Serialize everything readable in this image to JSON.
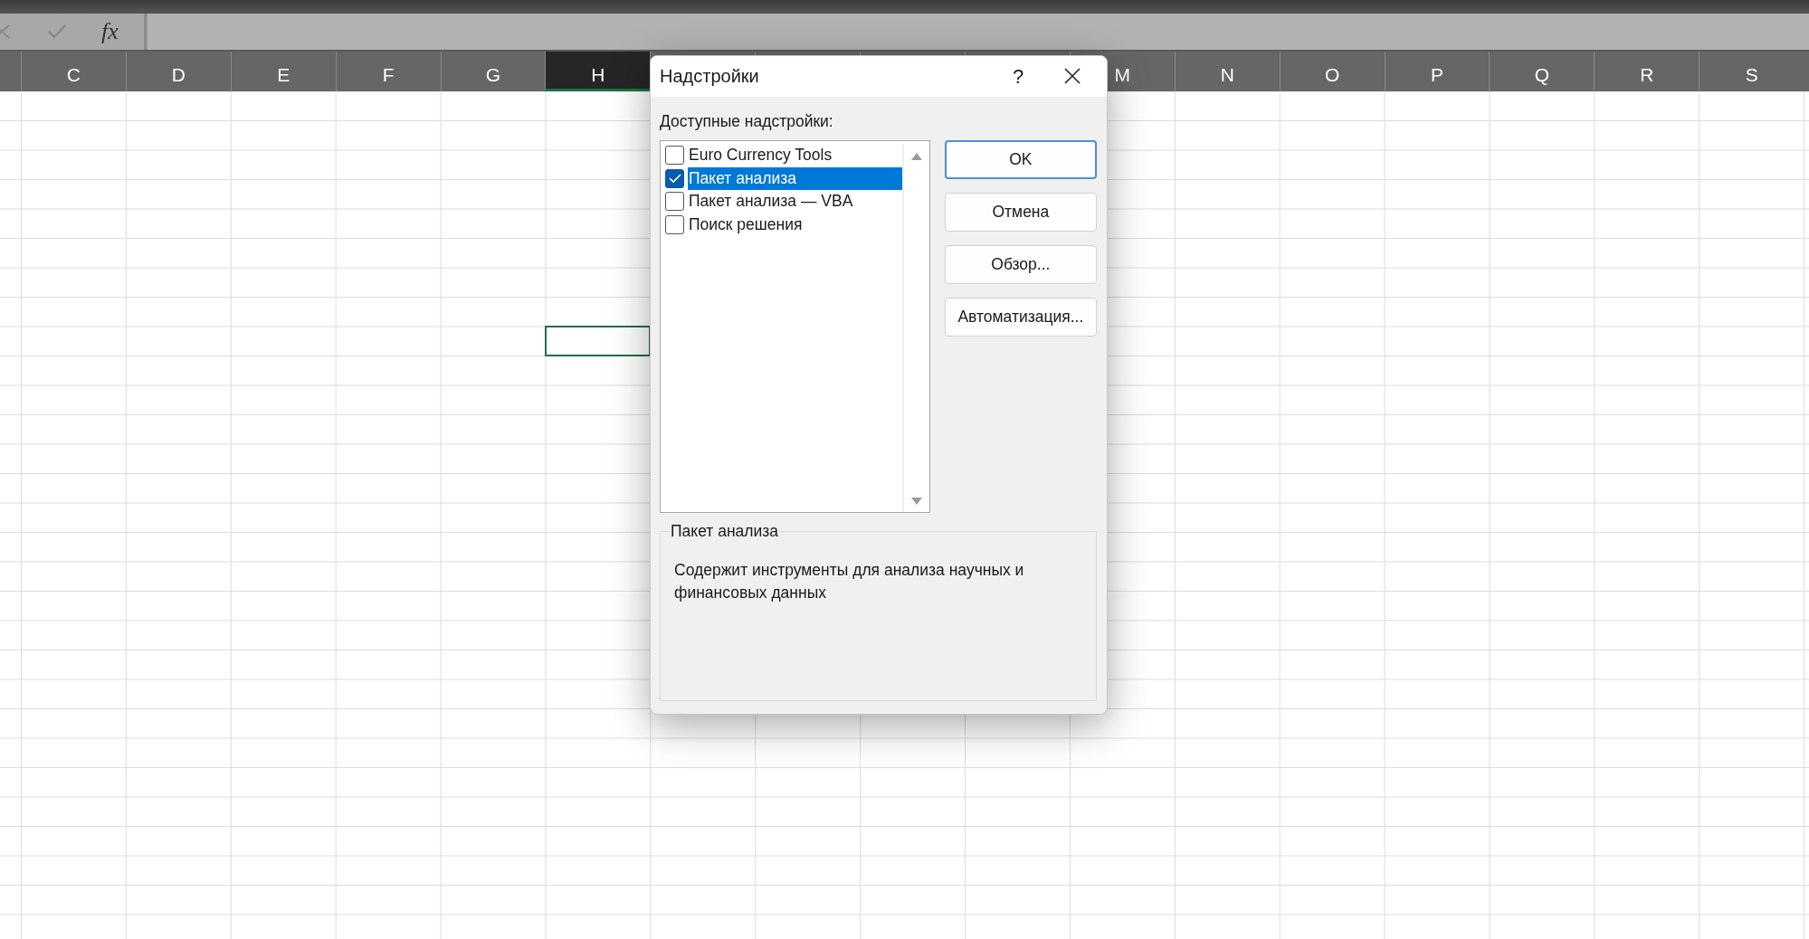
{
  "formula_bar": {
    "function_label": "fx"
  },
  "columns": [
    {
      "label": "C",
      "selected": false
    },
    {
      "label": "D",
      "selected": false
    },
    {
      "label": "E",
      "selected": false
    },
    {
      "label": "F",
      "selected": false
    },
    {
      "label": "G",
      "selected": false
    },
    {
      "label": "H",
      "selected": true
    },
    {
      "label": "M",
      "selected": false
    },
    {
      "label": "N",
      "selected": false
    },
    {
      "label": "O",
      "selected": false
    },
    {
      "label": "P",
      "selected": false
    },
    {
      "label": "Q",
      "selected": false
    },
    {
      "label": "R",
      "selected": false
    },
    {
      "label": "S",
      "selected": false
    }
  ],
  "dialog": {
    "title": "Надстройки",
    "help": "?",
    "list_label": "Доступные надстройки:",
    "addins": [
      {
        "label": "Euro Currency Tools",
        "checked": false,
        "selected": false
      },
      {
        "label": "Пакет анализа",
        "checked": true,
        "selected": true
      },
      {
        "label": "Пакет анализа — VBA",
        "checked": false,
        "selected": false
      },
      {
        "label": "Поиск решения",
        "checked": false,
        "selected": false
      }
    ],
    "buttons": [
      {
        "label": "OK",
        "default": true
      },
      {
        "label": "Отмена",
        "default": false
      },
      {
        "label": "Обзор...",
        "default": false
      },
      {
        "label": "Автоматизация...",
        "default": false
      }
    ],
    "details": {
      "title": "Пакет анализа",
      "description": "Содержит инструменты для анализа научных и финансовых данных"
    }
  }
}
